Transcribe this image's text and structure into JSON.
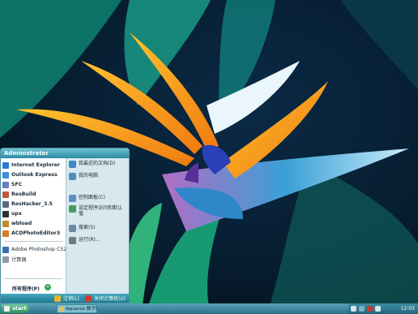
{
  "start_menu": {
    "user": "Administrator",
    "pinned": [
      {
        "label": "Internet Explorer",
        "icon": "internet-explorer-icon",
        "color": "#2a7bd0"
      },
      {
        "label": "Outlook Express",
        "icon": "outlook-express-icon",
        "color": "#3b8fd6"
      },
      {
        "label": "SFC",
        "icon": "sfc-icon",
        "color": "#6a7dc0"
      },
      {
        "label": "ResBuild",
        "icon": "resbuild-icon",
        "color": "#c2563e"
      },
      {
        "label": "ResHacker_3.5",
        "icon": "reshacker-icon",
        "color": "#5a6a7a"
      },
      {
        "label": "upx",
        "icon": "upx-icon",
        "color": "#2f2f2f"
      },
      {
        "label": "wbload",
        "icon": "wbload-icon",
        "color": "#c08a2a"
      },
      {
        "label": "ACDPhotoEditor3",
        "icon": "acd-photo-editor-icon",
        "color": "#d87b27"
      }
    ],
    "recent": [
      {
        "label": "Adobe Photoshop CS2",
        "icon": "photoshop-icon",
        "color": "#3d6fb0"
      },
      {
        "label": "计算器",
        "icon": "calculator-icon",
        "color": "#8d98a8"
      }
    ],
    "all_programs": "所有程序(P)",
    "right": [
      {
        "label": "我最近的文档(D)",
        "icon": "recent-documents-icon",
        "color": "#3e87c6"
      },
      {
        "label": "我的电脑",
        "icon": "my-computer-icon",
        "color": "#4d8fb8"
      },
      {
        "label": "控制面板(C)",
        "icon": "control-panel-icon",
        "color": "#5c8fc4"
      },
      {
        "label": "设定程序访问和默认值",
        "icon": "program-defaults-icon",
        "color": "#4a9a60"
      },
      {
        "label": "搜索(S)",
        "icon": "search-icon",
        "color": "#6b8aa0"
      },
      {
        "label": "运行(R)...",
        "icon": "run-icon",
        "color": "#6a7c88"
      }
    ],
    "logoff": "注销(L)",
    "shutdown": "关闭计算机(U)"
  },
  "taskbar": {
    "start_label": "start",
    "window_title": "Aquanox 狮子胶印版",
    "clock": "12:03"
  },
  "colors": {
    "flower_orange": "#f2a21e",
    "flower_blue": "#3fa2e6",
    "bg_teal": "#0d6f6c"
  }
}
